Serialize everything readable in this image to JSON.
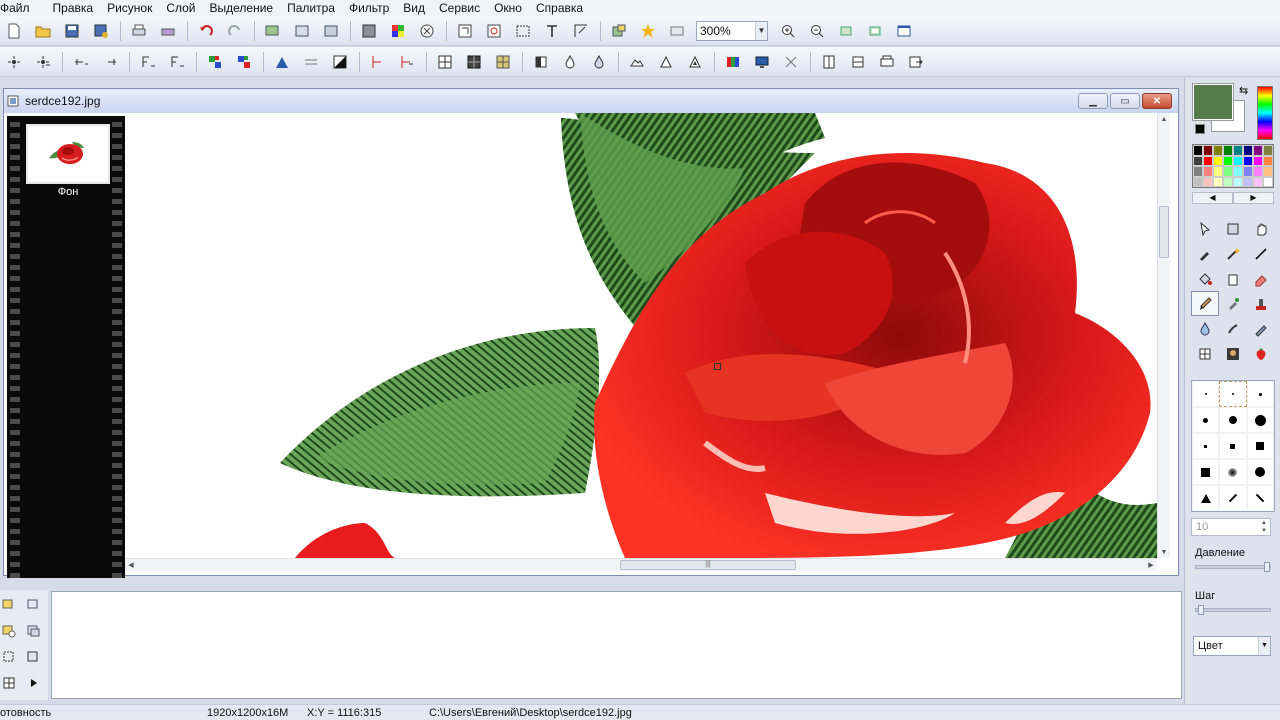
{
  "menu": [
    "Файл",
    "Правка",
    "Рисунок",
    "Слой",
    "Выделение",
    "Палитра",
    "Фильтр",
    "Вид",
    "Сервис",
    "Окно",
    "Справка"
  ],
  "toolbar": {
    "zoom_value": "300%"
  },
  "document": {
    "title": "serdce192.jpg",
    "layer_name": "Фон"
  },
  "status": {
    "state": "отовность",
    "image_info": "1920x1200x16M",
    "coords": "X:Y = 1116:315",
    "path": "C:\\Users\\Евгений\\Desktop\\serdce192.jpg"
  },
  "panel": {
    "fg_color": "#577a4b",
    "bg_color": "#ffffff",
    "size_value": "10",
    "pressure_label": "Давление",
    "step_label": "Шаг",
    "mode_value": "Цвет"
  },
  "icons": {
    "toolbar1": [
      "new-icon",
      "open-icon",
      "save-icon",
      "save-as-icon",
      "print-icon",
      "scan-icon",
      "undo-icon",
      "redo-icon",
      "layer-add-icon",
      "layer-merge-icon",
      "layer-flatten-icon",
      "frame-icon",
      "palette-icon",
      "effect-icon",
      "crop-icon",
      "rotate-icon",
      "select-icon",
      "text-icon",
      "resize-icon",
      "plugins-icon",
      "star-icon",
      "fullscreen-icon",
      "zoom-in-icon",
      "zoom-out-icon",
      "fit-icon",
      "actual-size-icon",
      "window-icon"
    ],
    "toolbar2": [
      "select-add-icon",
      "select-sub-icon",
      "shift-left-icon",
      "shift-right-icon",
      "flip-h-icon",
      "flip-v-icon",
      "color-swap-icon",
      "color-grid-icon",
      "brightness-icon",
      "sharpen-icon",
      "invert-icon",
      "auto-level-icon",
      "auto-contrast-icon",
      "grid-icon",
      "grid-dark-icon",
      "grid-color-icon",
      "half-icon",
      "drop-icon",
      "drop-outline-icon",
      "triangle-icon",
      "triangle-outline-icon",
      "triangle-small-icon",
      "rgb-icon",
      "monitor-icon",
      "noise-icon",
      "page-icon",
      "doc-icon",
      "print-preview-icon",
      "export-icon"
    ],
    "tools": [
      "pointer-icon",
      "layer-icon",
      "hand-icon",
      "picker-icon",
      "magic-wand-icon",
      "line-icon",
      "fill-icon",
      "bucket-icon",
      "eraser-icon",
      "brush-icon",
      "airbrush-icon",
      "stamp-icon",
      "drop-icon",
      "smudge-icon",
      "pencil-icon",
      "grid-tool-icon",
      "portrait-icon",
      "strawberry-icon"
    ]
  }
}
